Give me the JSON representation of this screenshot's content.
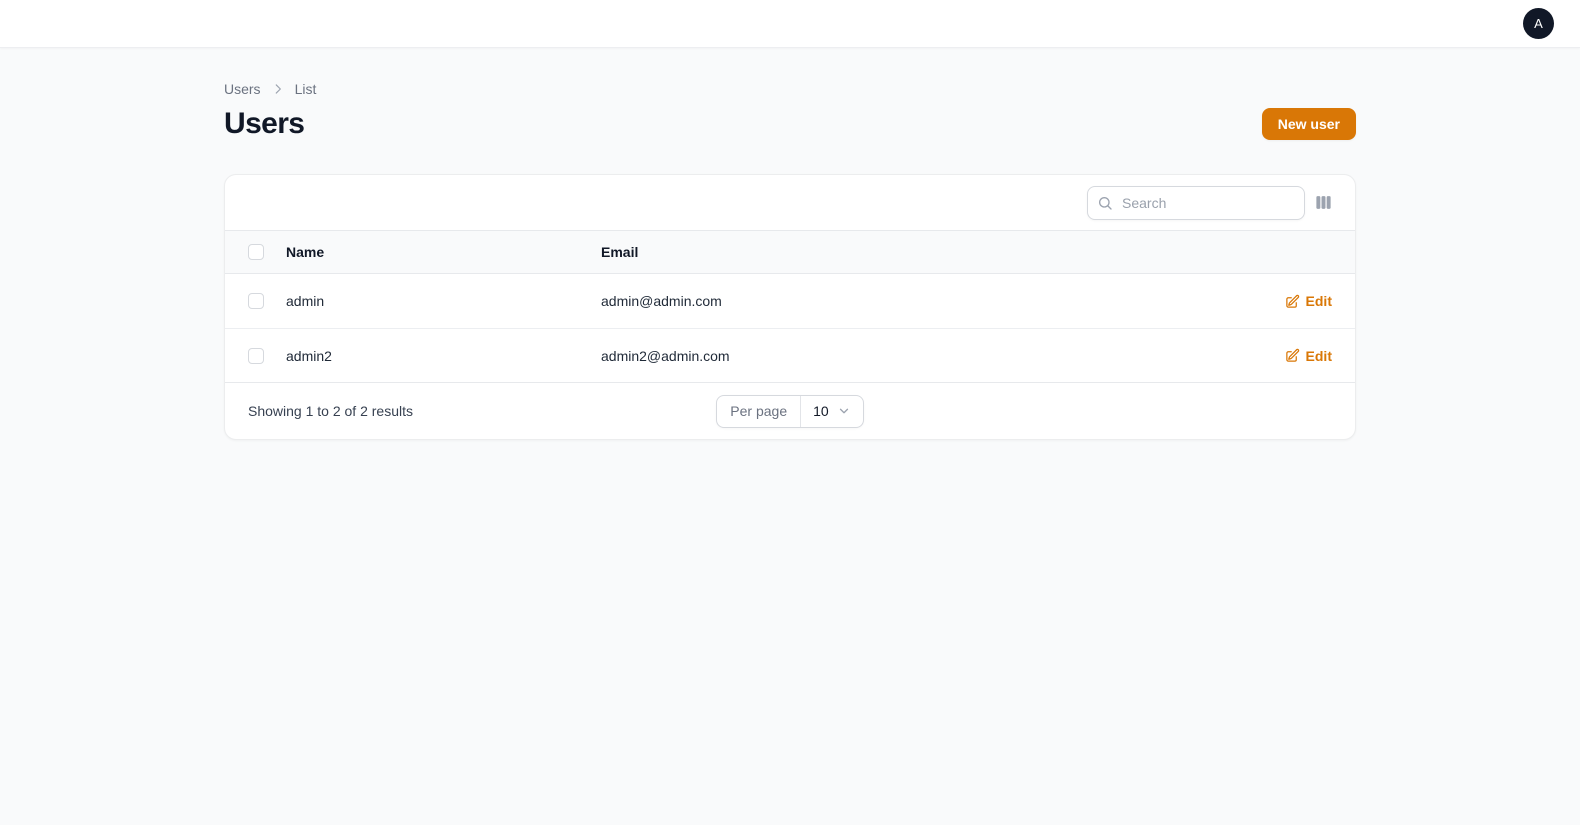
{
  "topbar": {
    "avatar_initial": "A"
  },
  "breadcrumb": {
    "items": [
      "Users",
      "List"
    ]
  },
  "page": {
    "title": "Users"
  },
  "actions": {
    "new_user_label": "New user"
  },
  "table": {
    "search_placeholder": "Search",
    "icons": [
      "search-icon",
      "view-columns-icon",
      "pencil-square-icon",
      "chevron-down-icon",
      "chevron-right-icon"
    ],
    "columns": [
      "Name",
      "Email"
    ],
    "rows": [
      {
        "name": "admin",
        "email": "admin@admin.com",
        "edit_label": "Edit"
      },
      {
        "name": "admin2",
        "email": "admin2@admin.com",
        "edit_label": "Edit"
      }
    ],
    "footer": {
      "summary": "Showing 1 to 2 of 2 results",
      "per_page_label": "Per page",
      "per_page_value": "10"
    }
  },
  "colors": {
    "primary": "#d97706",
    "avatar_bg": "#111827",
    "page_bg": "#f9fafb"
  }
}
